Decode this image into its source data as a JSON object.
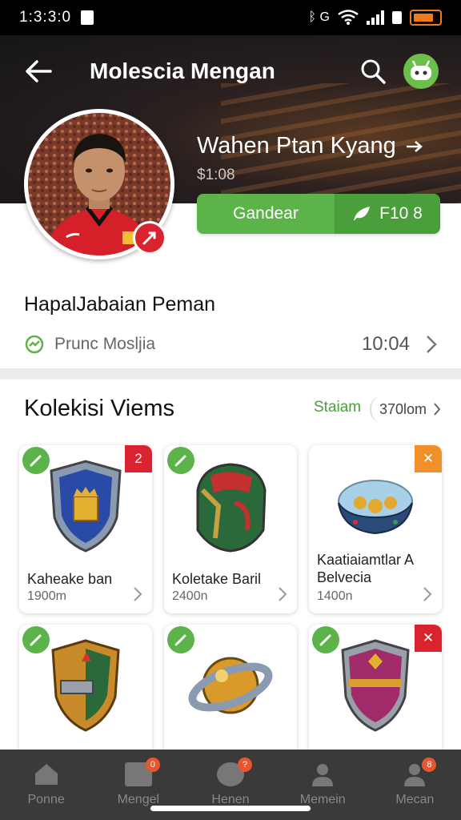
{
  "status_bar": {
    "time": "1:3:3:0",
    "network": "ᛒ G"
  },
  "header": {
    "title": "Molescia Mengan"
  },
  "profile": {
    "name": "Wahen Ptan Kyang",
    "sub": "$1:08",
    "follow_label": "Gandear",
    "count_label": "F10 8"
  },
  "section": {
    "title": "HapalJabaian Peman",
    "status_label": "Prunc Mosljia",
    "status_value": "10:04"
  },
  "collection": {
    "title": "Kolekisi Viems",
    "link": "Staiam",
    "filter": "370lom",
    "items": [
      {
        "name": "Kaheake ban",
        "price": "1900m",
        "corner": "2",
        "corner_color": "#d9232e"
      },
      {
        "name": "Koletake Baril",
        "price": "2400n",
        "corner": "",
        "corner_color": ""
      },
      {
        "name": "Kaatiaiamtlar A Belvecia",
        "price": "1400n",
        "corner": "✕",
        "corner_color": "#f0902a"
      },
      {
        "name": "",
        "price": "",
        "corner": "",
        "corner_color": ""
      },
      {
        "name": "",
        "price": "",
        "corner": "",
        "corner_color": ""
      },
      {
        "name": "",
        "price": "",
        "corner": "✕",
        "corner_color": "#d9232e"
      }
    ]
  },
  "bottom_nav": [
    {
      "label": "Ponne",
      "badge": ""
    },
    {
      "label": "Mengel",
      "badge": "0"
    },
    {
      "label": "Henen",
      "badge": "?"
    },
    {
      "label": "Memein",
      "badge": ""
    },
    {
      "label": "Mecan",
      "badge": "8"
    }
  ]
}
